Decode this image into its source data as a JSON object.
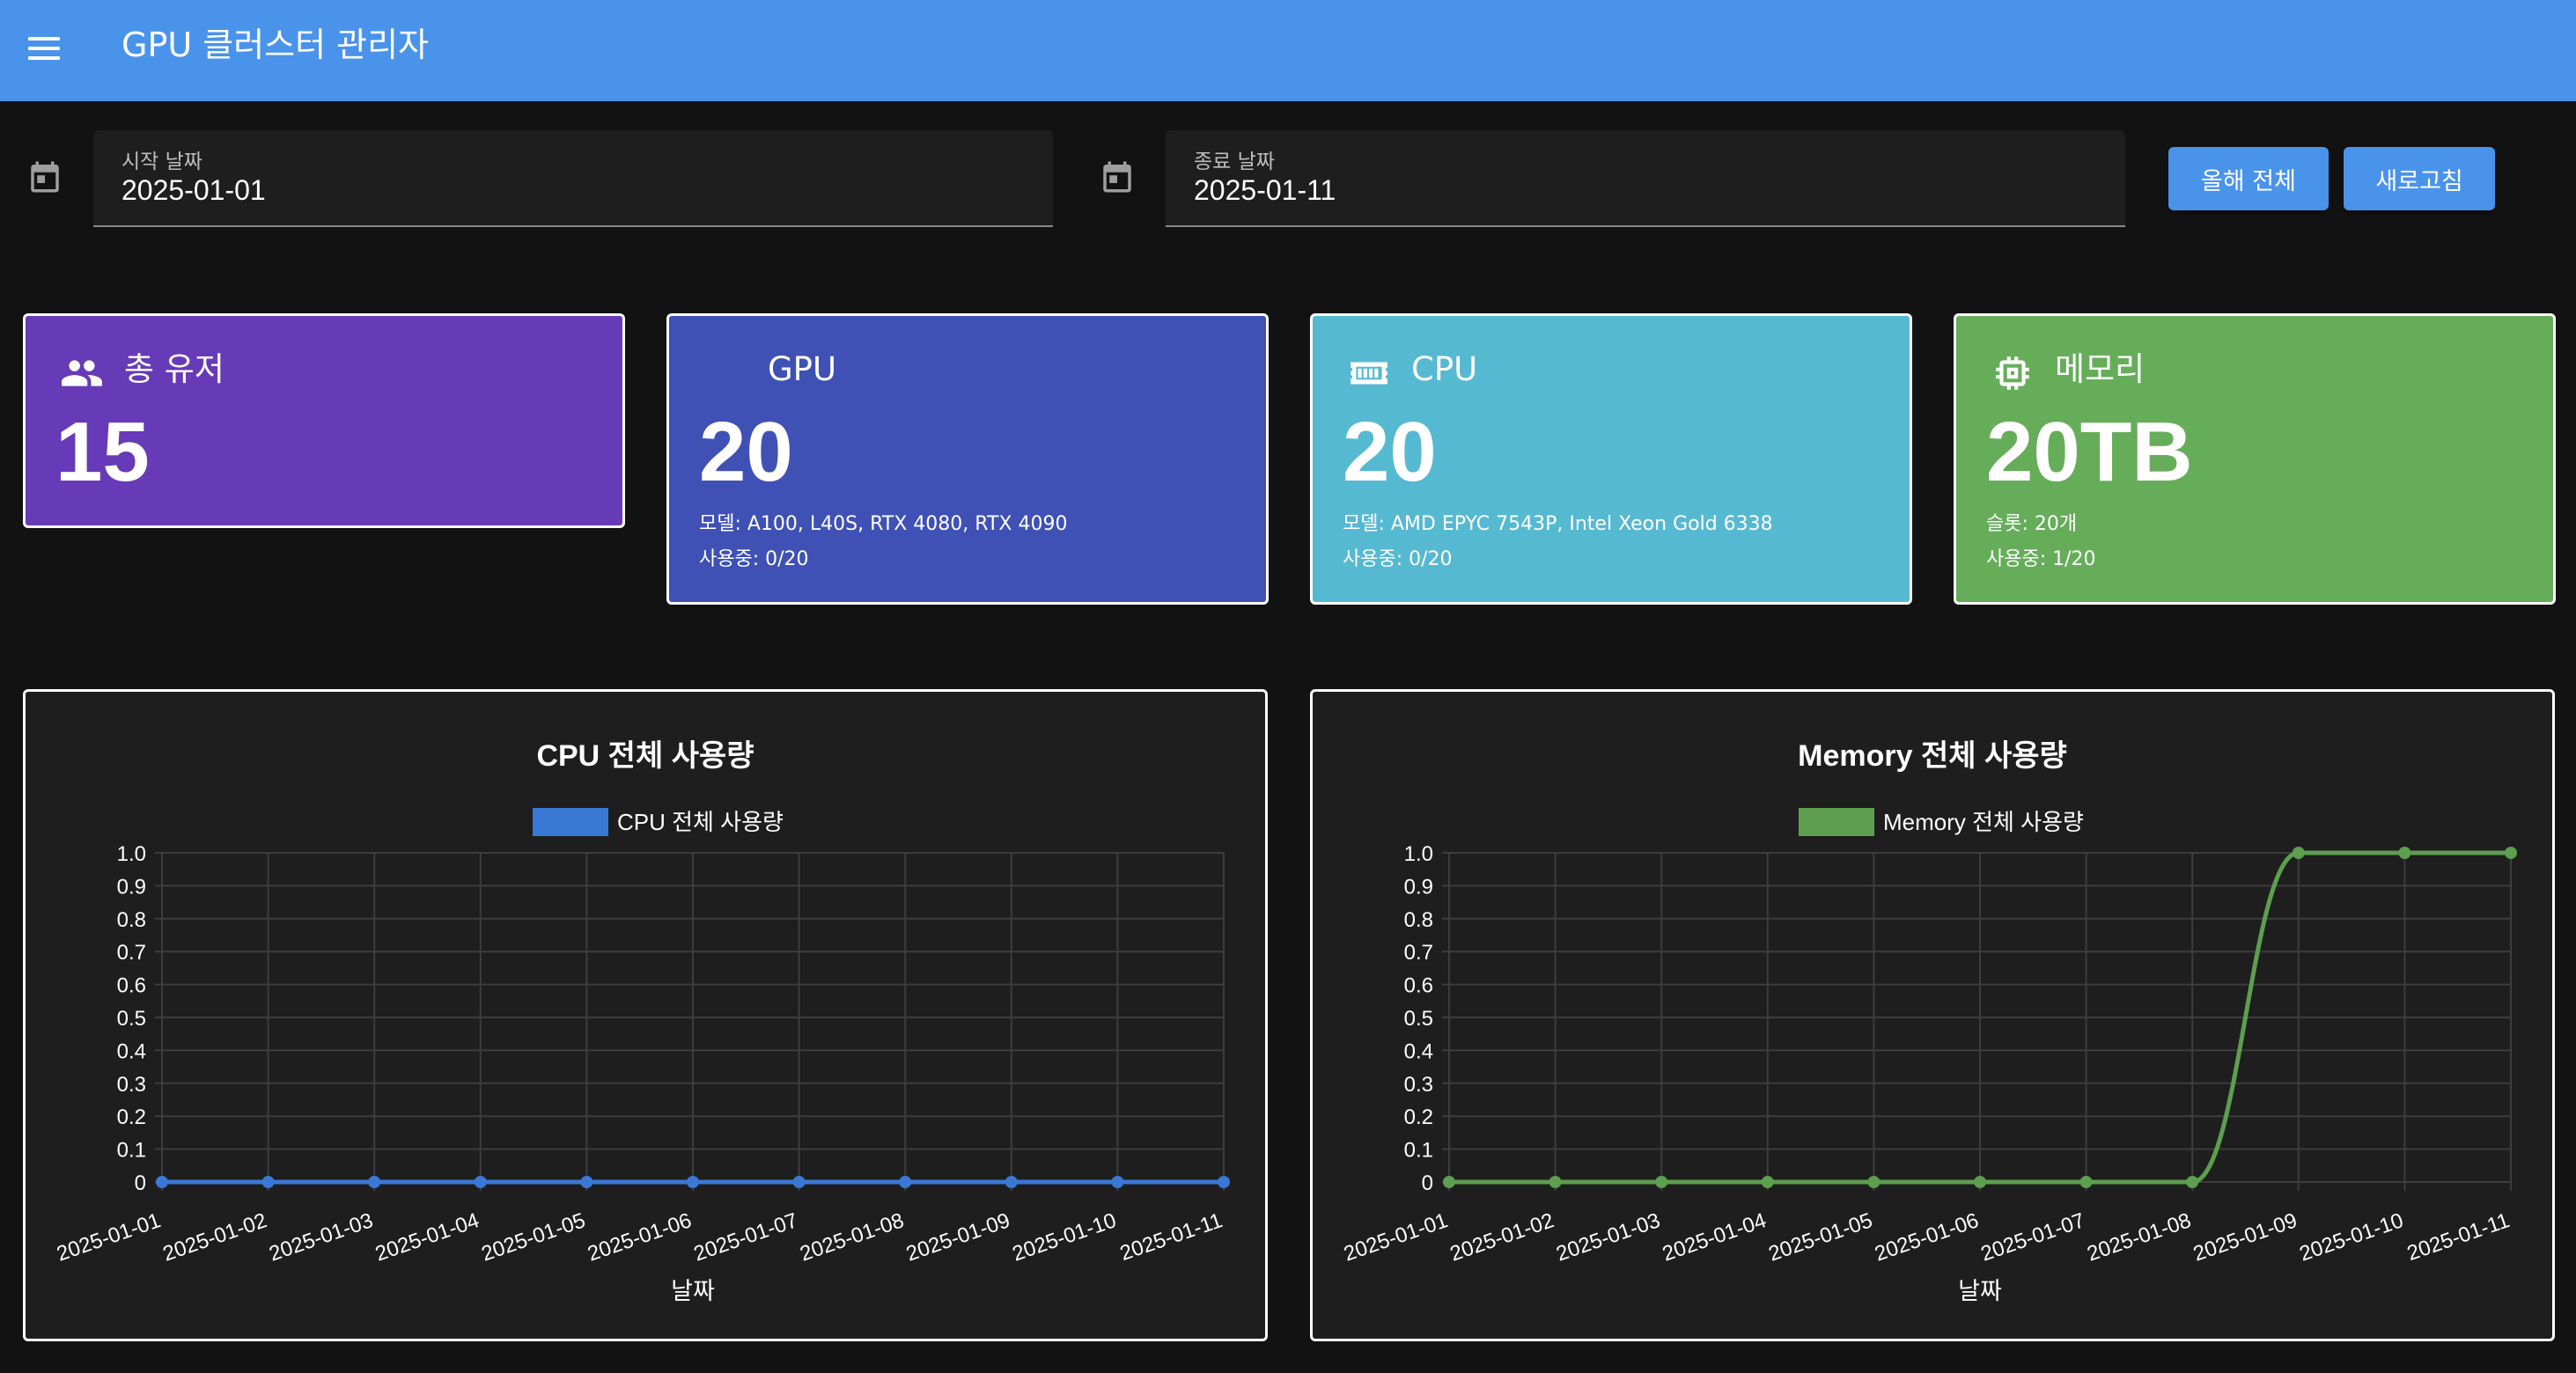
{
  "app": {
    "title": "GPU 클러스터 관리자",
    "menu_icon": "menu-icon"
  },
  "filters": {
    "start": {
      "label": "시작 날짜",
      "value": "2025-01-01",
      "icon": "calendar-icon"
    },
    "end": {
      "label": "종료 날짜",
      "value": "2025-01-11",
      "icon": "calendar-icon"
    },
    "this_year_label": "올해 전체",
    "refresh_label": "새로고침",
    "button_color": "#4a93ea"
  },
  "cards": {
    "users": {
      "title": "총 유저",
      "value": "15",
      "color": "#673ab7",
      "icon": "people-icon"
    },
    "gpu": {
      "title": "GPU",
      "value": "20",
      "models": "모델: A100, L40S, RTX 4080, RTX 4090",
      "usage": "사용중: 0/20",
      "color": "#3f51b5"
    },
    "cpu": {
      "title": "CPU",
      "value": "20",
      "models": "모델: AMD EPYC 7543P, Intel Xeon Gold 6338",
      "usage": "사용중: 0/20",
      "color": "#56b9d2",
      "icon": "cpu-icon"
    },
    "memory": {
      "title": "메모리",
      "value": "20TB",
      "slots": "슬롯: 20개",
      "usage": "사용중: 1/20",
      "color": "#66ad5a",
      "icon": "memory-chip-icon"
    }
  },
  "chart_data": [
    {
      "type": "line",
      "title": "CPU 전체 사용량",
      "xlabel": "날짜",
      "ylabel": "",
      "x": [
        "2025-01-01",
        "2025-01-02",
        "2025-01-03",
        "2025-01-04",
        "2025-01-05",
        "2025-01-06",
        "2025-01-07",
        "2025-01-08",
        "2025-01-09",
        "2025-01-10",
        "2025-01-11"
      ],
      "series": [
        {
          "name": "CPU 전체 사용량",
          "color": "#3a78d6",
          "values": [
            0,
            0,
            0,
            0,
            0,
            0,
            0,
            0,
            0,
            0,
            0
          ]
        }
      ],
      "ylim": [
        0,
        1
      ],
      "yticks": [
        "0",
        "0.1",
        "0.2",
        "0.3",
        "0.4",
        "0.5",
        "0.6",
        "0.7",
        "0.8",
        "0.9",
        "1.0"
      ],
      "grid": true,
      "legend": "top-center"
    },
    {
      "type": "line",
      "title": "Memory 전체 사용량",
      "xlabel": "날짜",
      "ylabel": "",
      "x": [
        "2025-01-01",
        "2025-01-02",
        "2025-01-03",
        "2025-01-04",
        "2025-01-05",
        "2025-01-06",
        "2025-01-07",
        "2025-01-08",
        "2025-01-09",
        "2025-01-10",
        "2025-01-11"
      ],
      "series": [
        {
          "name": "Memory 전체 사용량",
          "color": "#5d9e4f",
          "values": [
            0,
            0,
            0,
            0,
            0,
            0,
            0,
            0,
            1,
            1,
            1
          ]
        }
      ],
      "ylim": [
        0,
        1
      ],
      "yticks": [
        "0",
        "0.1",
        "0.2",
        "0.3",
        "0.4",
        "0.5",
        "0.6",
        "0.7",
        "0.8",
        "0.9",
        "1.0"
      ],
      "grid": true,
      "legend": "top-center"
    }
  ]
}
